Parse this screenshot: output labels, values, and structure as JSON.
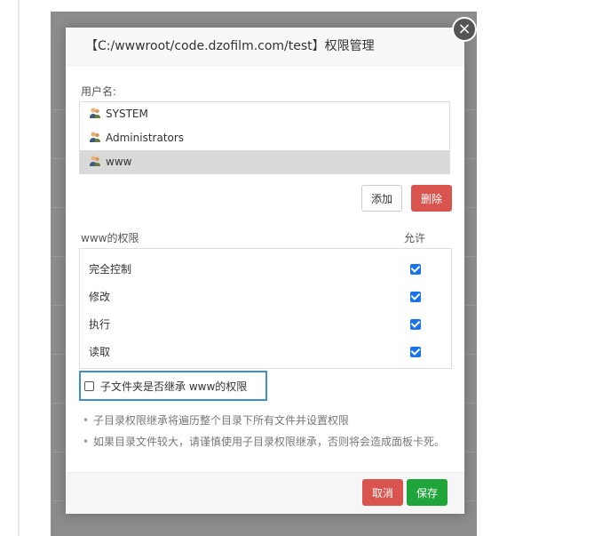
{
  "dialog": {
    "title": "【C:/wwwroot/code.dzofilm.com/test】权限管理",
    "close_glyph": "×",
    "user_label": "用户名:",
    "users": [
      {
        "name": "SYSTEM",
        "icon": "user-group-icon",
        "selected": false
      },
      {
        "name": "Administrators",
        "icon": "user-group-icon",
        "selected": false
      },
      {
        "name": "www",
        "icon": "user-group-icon",
        "selected": true
      }
    ],
    "add_label": "添加",
    "delete_label": "删除",
    "permissions_title": "www的权限",
    "allow_label": "允许",
    "permissions": [
      {
        "name": "完全控制",
        "allowed": true
      },
      {
        "name": "修改",
        "allowed": true
      },
      {
        "name": "执行",
        "allowed": true
      },
      {
        "name": "读取",
        "allowed": true
      }
    ],
    "inherit_label": "子文件夹是否继承 www的权限",
    "inherit_checked": false,
    "tips": [
      "子目录权限继承将遍历整个目录下所有文件并设置权限",
      "如果目录文件较大，请谨慎使用子目录权限继承，否则将会造成面板卡死。"
    ],
    "cancel_label": "取消",
    "save_label": "保存"
  },
  "colors": {
    "danger": "#d9534f",
    "success": "#20a53a",
    "highlight_border": "#3c8fd1",
    "checkbox": "#1a73e8"
  }
}
